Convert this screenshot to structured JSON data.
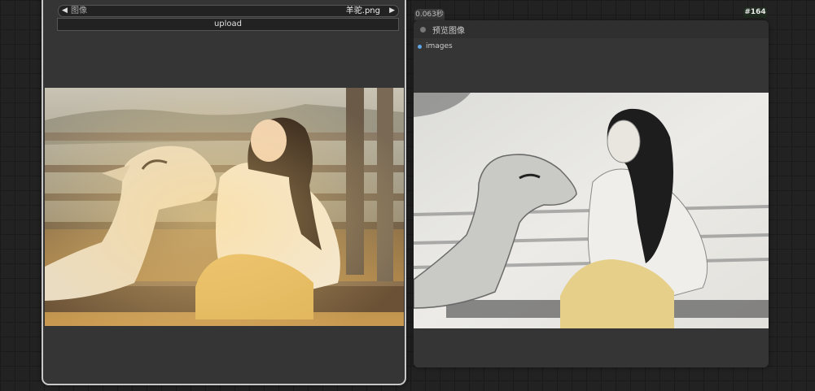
{
  "load_node": {
    "image_combo": {
      "label": "图像",
      "value": "羊驼.png",
      "prev_icon": "triangle-left-icon",
      "next_icon": "triangle-right-icon"
    },
    "upload_label": "upload"
  },
  "preview_node": {
    "exec_time": "0.063秒",
    "node_id": "#164",
    "title": "预览图像",
    "input_label": "images",
    "input_color": "#5ea8e6"
  },
  "colors": {
    "canvas_bg": "#222222",
    "node_bg": "#353535",
    "selected_outline": "#c8c8c8"
  }
}
